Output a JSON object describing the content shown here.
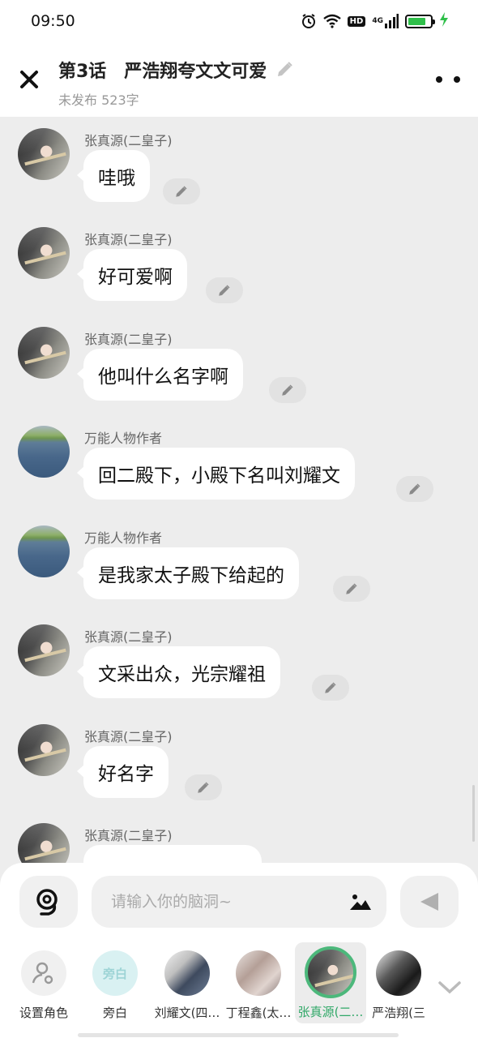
{
  "status_bar": {
    "time": "09:50",
    "network": "4G",
    "hd": "HD",
    "battery_level": 0.8,
    "icons": [
      "alarm-icon",
      "wifi-icon",
      "hd-icon",
      "signal-icon",
      "battery-icon",
      "charging-icon"
    ]
  },
  "header": {
    "title": "第3话　严浩翔夸文文可爱",
    "subtitle": "未发布 523字",
    "close_icon": "close-icon",
    "edit_icon": "pencil-icon",
    "more_icon": "more-dots-icon"
  },
  "messages": [
    {
      "sender": "张真源(二皇子)",
      "text": "哇哦",
      "avatar": "prince"
    },
    {
      "sender": "张真源(二皇子)",
      "text": "好可爱啊",
      "avatar": "prince"
    },
    {
      "sender": "张真源(二皇子)",
      "text": "他叫什么名字啊",
      "avatar": "prince"
    },
    {
      "sender": "万能人物作者",
      "text": "回二殿下，小殿下名叫刘耀文",
      "avatar": "lake"
    },
    {
      "sender": "万能人物作者",
      "text": "是我家太子殿下给起的",
      "avatar": "lake"
    },
    {
      "sender": "张真源(二皇子)",
      "text": "文采出众，光宗耀祖",
      "avatar": "prince"
    },
    {
      "sender": "张真源(二皇子)",
      "text": "好名字",
      "avatar": "prince"
    },
    {
      "sender": "张真源(二皇子)",
      "text": "",
      "avatar": "prince"
    }
  ],
  "composer": {
    "placeholder": "请输入你的脑洞~",
    "value": "",
    "voice_icon": "voice-icon",
    "image_icon": "image-icon",
    "send_icon": "send-icon"
  },
  "roles": [
    {
      "label": "设置角色",
      "type": "settings"
    },
    {
      "label": "旁白",
      "type": "aside",
      "avatar_text": "旁白"
    },
    {
      "label": "刘耀文(四…",
      "type": "p1"
    },
    {
      "label": "丁程鑫(太…",
      "type": "p2"
    },
    {
      "label": "张真源(二…",
      "type": "prince",
      "selected": true
    },
    {
      "label": "严浩翔(三",
      "type": "p3"
    }
  ],
  "colors": {
    "accent": "#31a868",
    "bubble": "#ffffff",
    "background": "#ededed"
  }
}
